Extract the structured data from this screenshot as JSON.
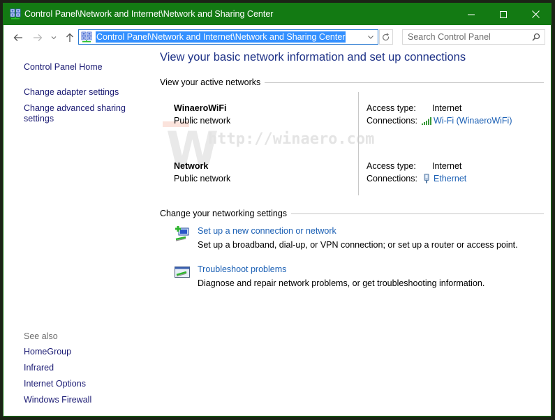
{
  "window": {
    "title": "Control Panel\\Network and Internet\\Network and Sharing Center",
    "accent_color": "#137a13",
    "controls": {
      "minimize_icon": "minimize-icon",
      "maximize_icon": "maximize-icon",
      "close_icon": "close-icon"
    }
  },
  "navbar": {
    "back_icon": "arrow-left-icon",
    "forward_icon": "arrow-right-icon",
    "recent_icon": "chevron-down-icon",
    "up_icon": "arrow-up-icon",
    "address": {
      "value": "Control Panel\\Network and Internet\\Network and Sharing Center",
      "icon": "network-center-icon",
      "selection_color": "#3390ff"
    },
    "refresh_icon": "refresh-icon",
    "search": {
      "placeholder": "Search Control Panel",
      "value": "",
      "icon": "search-icon"
    }
  },
  "sidebar": {
    "home": "Control Panel Home",
    "links": [
      "Change adapter settings",
      "Change advanced sharing settings"
    ],
    "see_also_heading": "See also",
    "see_also": [
      "HomeGroup",
      "Infrared",
      "Internet Options",
      "Windows Firewall"
    ]
  },
  "main": {
    "title": "View your basic network information and set up connections",
    "active_networks_heading": "View your active networks",
    "networks": [
      {
        "name": "WinaeroWiFi",
        "category": "Public network",
        "access_type_label": "Access type:",
        "access_type": "Internet",
        "connections_label": "Connections:",
        "connection": "Wi-Fi (WinaeroWiFi)",
        "connection_icon": "wifi-signal-icon"
      },
      {
        "name": "Network",
        "category": "Public network",
        "access_type_label": "Access type:",
        "access_type": "Internet",
        "connections_label": "Connections:",
        "connection": "Ethernet",
        "connection_icon": "ethernet-icon"
      }
    ],
    "settings_heading": "Change your networking settings",
    "tasks": [
      {
        "link": "Set up a new connection or network",
        "description": "Set up a broadband, dial-up, or VPN connection; or set up a router or access point.",
        "icon": "new-connection-icon"
      },
      {
        "link": "Troubleshoot problems",
        "description": "Diagnose and repair network problems, or get troubleshooting information.",
        "icon": "troubleshoot-icon"
      }
    ],
    "watermark": {
      "letter": "W",
      "url": "http://winaero.com"
    }
  }
}
